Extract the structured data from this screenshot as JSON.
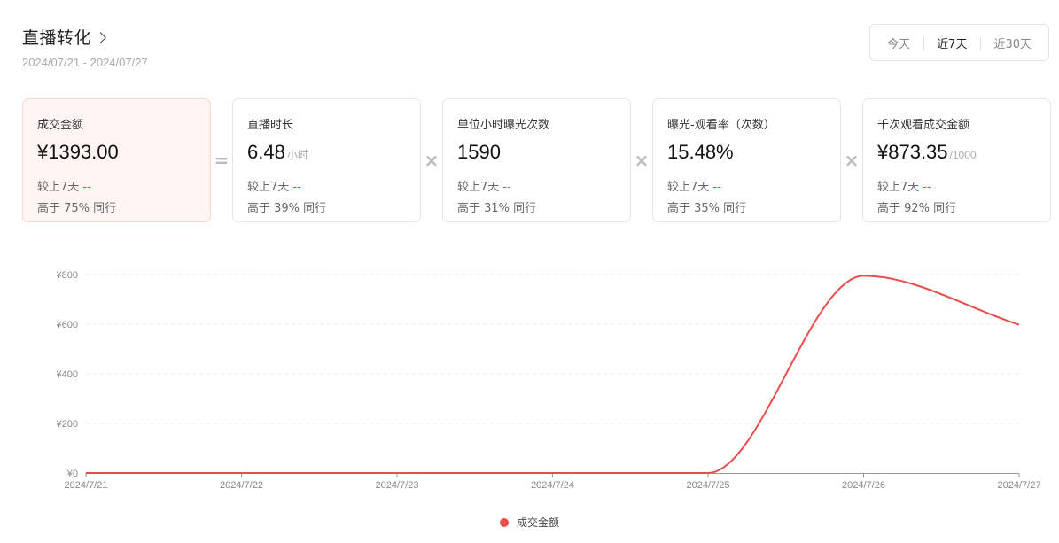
{
  "header": {
    "title": "直播转化",
    "date_range": "2024/07/21 - 2024/07/27"
  },
  "range_options": [
    "今天",
    "近7天",
    "近30天"
  ],
  "range_selected": "近7天",
  "cards": [
    {
      "label": "成交金额",
      "value": "¥1393.00",
      "unit": "",
      "compare_label": "较上7天",
      "compare_value": "--",
      "rank": "高于 75% 同行"
    },
    {
      "label": "直播时长",
      "value": "6.48",
      "unit": "小时",
      "compare_label": "较上7天",
      "compare_value": "--",
      "rank": "高于 39% 同行"
    },
    {
      "label": "单位小时曝光次数",
      "value": "1590",
      "unit": "",
      "compare_label": "较上7天",
      "compare_value": "--",
      "rank": "高于 31% 同行"
    },
    {
      "label": "曝光-观看率（次数）",
      "value": "15.48%",
      "unit": "",
      "compare_label": "较上7天",
      "compare_value": "--",
      "rank": "高于 35% 同行"
    },
    {
      "label": "千次观看成交金额",
      "value": "¥873.35",
      "unit": "/1000",
      "compare_label": "较上7天",
      "compare_value": "--",
      "rank": "高于 92% 同行"
    }
  ],
  "operators": [
    "=",
    "×",
    "×",
    "×"
  ],
  "colors": {
    "accent": "#e84c4c",
    "highlight_bg": "#fff6f4"
  },
  "chart_data": {
    "type": "line",
    "x": [
      "2024/7/21",
      "2024/7/22",
      "2024/7/23",
      "2024/7/24",
      "2024/7/25",
      "2024/7/26",
      "2024/7/27"
    ],
    "series": [
      {
        "name": "成交金额",
        "values": [
          0,
          0,
          0,
          0,
          0,
          795,
          598
        ],
        "color": "#e84c4c"
      }
    ],
    "yticks": [
      "¥0",
      "¥200",
      "¥400",
      "¥600",
      "¥800"
    ],
    "ylim": [
      0,
      800
    ],
    "grid": true,
    "legend": "bottom-center"
  }
}
